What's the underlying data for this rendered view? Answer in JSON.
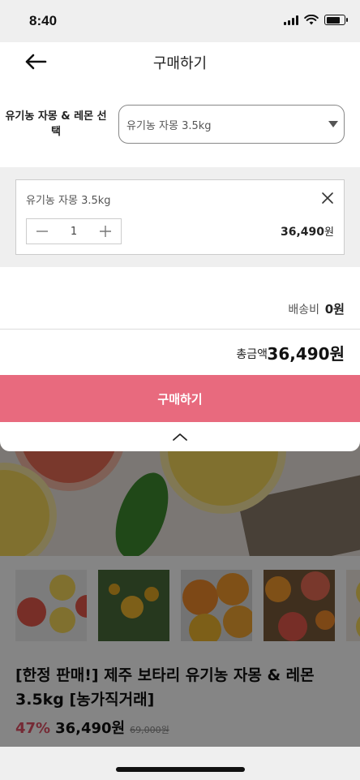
{
  "status_bar": {
    "time": "8:40"
  },
  "header": {
    "title": "구매하기",
    "back_icon": "arrow-left-icon"
  },
  "option": {
    "label": "유기농 자몽 & 레몬 선택",
    "selected_value": "유기농 자몽 3.5kg"
  },
  "selected_item": {
    "name": "유기농 자몽 3.5kg",
    "quantity": "1",
    "price": "36,490",
    "price_unit": "원"
  },
  "summary": {
    "shipping_label": "배송비",
    "shipping_value": "0원",
    "total_label": "총금액",
    "total_value": "36,490원"
  },
  "buy_button": {
    "label": "구매하기",
    "color": "#e86a7e"
  },
  "background_product": {
    "title": "[한정 판매!] 제주 보타리 유기농 자몽 & 레몬 3.5kg [농가직거래]",
    "discount": "47%",
    "sale_price": "36,490원",
    "original_price": "69,000원"
  },
  "colors": {
    "accent": "#e86a7e",
    "discount": "#e05266"
  }
}
